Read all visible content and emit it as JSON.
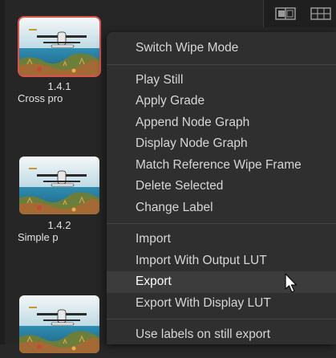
{
  "gallery": {
    "stills": [
      {
        "number": "1.4.1",
        "label": "Cross pro",
        "selected": true
      },
      {
        "number": "1.4.2",
        "label": "Simple p",
        "selected": false
      },
      {
        "number": "",
        "label": "",
        "selected": false
      }
    ],
    "selection_color": "#d9534f"
  },
  "toolbar": {
    "icons": [
      "split-view-icon",
      "grid-view-icon"
    ]
  },
  "context_menu": {
    "groups": [
      [
        {
          "label": "Switch Wipe Mode"
        }
      ],
      [
        {
          "label": "Play Still"
        },
        {
          "label": "Apply Grade"
        },
        {
          "label": "Append Node Graph"
        },
        {
          "label": "Display Node Graph"
        },
        {
          "label": "Match Reference Wipe Frame"
        },
        {
          "label": "Delete Selected"
        },
        {
          "label": "Change Label"
        }
      ],
      [
        {
          "label": "Import"
        },
        {
          "label": "Import With Output LUT"
        },
        {
          "label": "Export",
          "highlighted": true
        },
        {
          "label": "Export With Display LUT"
        }
      ],
      [
        {
          "label": "Use labels on still export"
        }
      ]
    ]
  }
}
